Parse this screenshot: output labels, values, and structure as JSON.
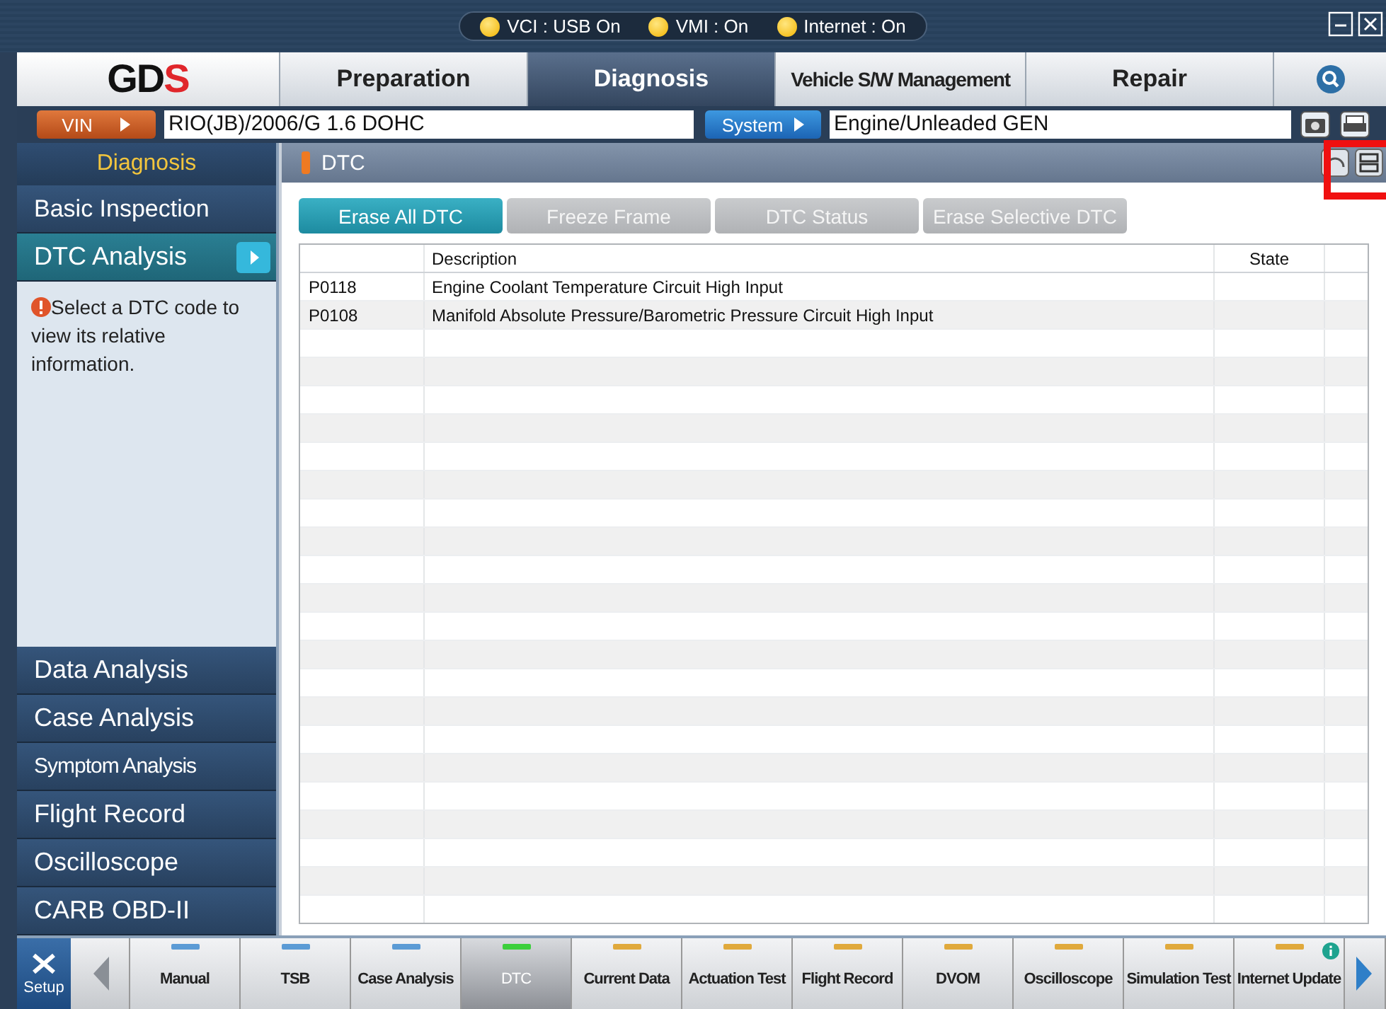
{
  "status_lights": [
    {
      "label": "VCI : USB On",
      "on": true
    },
    {
      "label": "VMI : On",
      "on": true
    },
    {
      "label": "Internet : On",
      "on": true
    }
  ],
  "logo": "GDS",
  "nav_tabs": [
    {
      "label": "Preparation",
      "selected": false
    },
    {
      "label": "Diagnosis",
      "selected": true
    },
    {
      "label": "Vehicle S/W Management",
      "selected": false
    },
    {
      "label": "Repair",
      "selected": false
    }
  ],
  "vehicle_bar": {
    "vin_button": "VIN",
    "vin_value": "RIO(JB)/2006/G 1.6 DOHC",
    "system_button": "System",
    "system_value": "Engine/Unleaded GEN"
  },
  "sidebar": {
    "title": "Diagnosis",
    "top_items": [
      {
        "label": "Basic Inspection",
        "selected": false
      },
      {
        "label": "DTC Analysis",
        "selected": true
      }
    ],
    "info": "Select a DTC code to view its relative information.",
    "bottom_items": [
      {
        "label": "Data Analysis",
        "selected": false
      },
      {
        "label": "Case Analysis",
        "selected": false
      },
      {
        "label": "Symptom Analysis",
        "selected": false
      },
      {
        "label": "Flight Record",
        "selected": false
      },
      {
        "label": "Oscilloscope",
        "selected": false
      },
      {
        "label": "CARB OBD-II",
        "selected": false
      }
    ]
  },
  "panel": {
    "title": "DTC",
    "buttons": [
      {
        "label": "Erase All DTC",
        "disabled": false
      },
      {
        "label": "Freeze Frame",
        "disabled": true
      },
      {
        "label": "DTC Status",
        "disabled": true
      },
      {
        "label": "Erase Selective DTC",
        "disabled": true
      }
    ],
    "table": {
      "columns": [
        "Description",
        "State"
      ],
      "rows": [
        {
          "code": "P0118",
          "description": "Engine Coolant Temperature Circuit High Input"
        },
        {
          "code": "P0108",
          "description": "Manifold Absolute Pressure/Barometric Pressure Circuit High Input"
        }
      ]
    }
  },
  "toolbar": {
    "setup": "Setup",
    "tools": [
      {
        "label": "Manual",
        "color": "#5b9bd5",
        "selected": false
      },
      {
        "label": "TSB",
        "color": "#5b9bd5",
        "selected": false
      },
      {
        "label": "Case Analysis",
        "color": "#5b9bd5",
        "selected": false
      },
      {
        "label": "DTC",
        "color": "#3ccf3c",
        "selected": true
      },
      {
        "label": "Current Data",
        "color": "#e0a93c",
        "selected": false
      },
      {
        "label": "Actuation Test",
        "color": "#e0a93c",
        "selected": false
      },
      {
        "label": "Flight Record",
        "color": "#e0a93c",
        "selected": false
      },
      {
        "label": "DVOM",
        "color": "#e0a93c",
        "selected": false
      },
      {
        "label": "Oscilloscope",
        "color": "#e0a93c",
        "selected": false
      },
      {
        "label": "Simulation Test",
        "color": "#e0a93c",
        "selected": false
      },
      {
        "label": "Internet Update",
        "color": "#e0a93c",
        "selected": false,
        "badge": true
      }
    ]
  }
}
